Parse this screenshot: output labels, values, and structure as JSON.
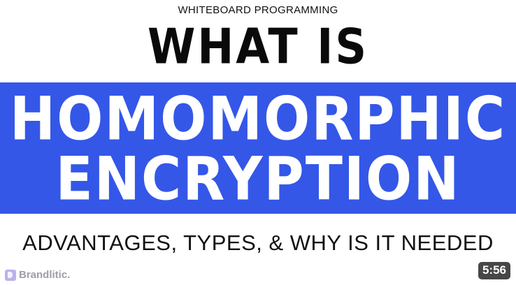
{
  "thumbnail": {
    "channel_tag": "WHITEBOARD PROGRAMMING",
    "headline_top": "WHAT IS",
    "headline_band": {
      "line1": "HOMOMORPHIC",
      "line2": "ENCRYPTION",
      "band_color": "#3457e8",
      "text_color": "#ffffff"
    },
    "subtitle": "ADVANTAGES, TYPES, & WHY IS IT NEEDED"
  },
  "watermark": {
    "icon": "brandlitic-logo-icon",
    "name": "Brandlitic."
  },
  "video": {
    "duration": "5:56"
  }
}
